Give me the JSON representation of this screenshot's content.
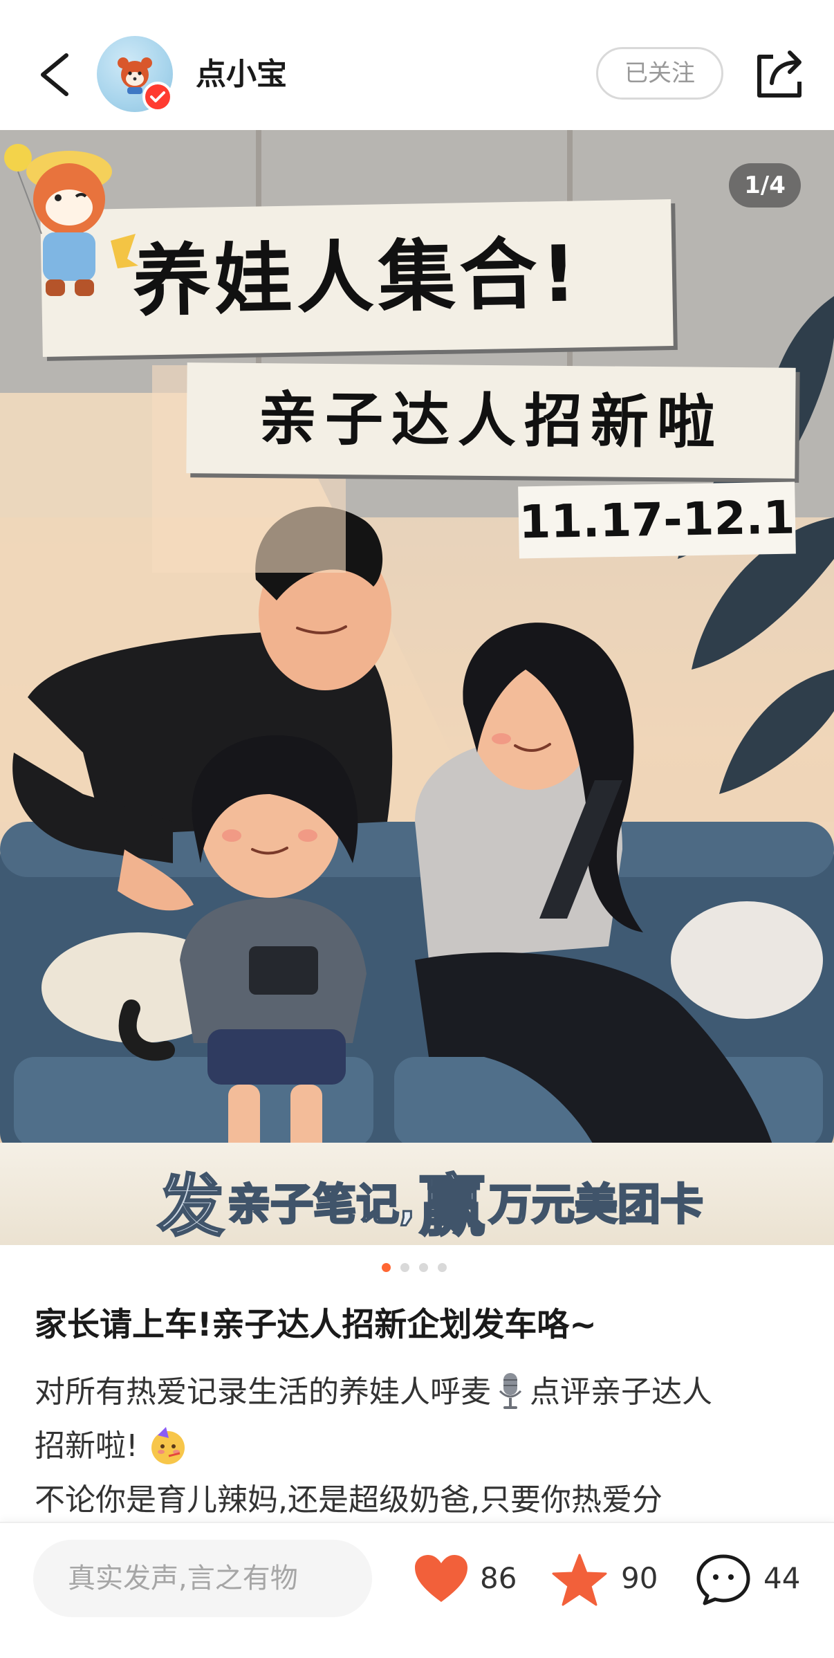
{
  "header": {
    "username": "点小宝",
    "follow_label": "已关注"
  },
  "hero": {
    "page_counter": "1/4",
    "headline": "养娃人集合!",
    "subheadline": "亲子达人招新啦",
    "date_range": "11.17-12.1",
    "promo": {
      "part1": "发",
      "part2": "亲子笔记,",
      "part3": "赢",
      "part4": "万元美团卡"
    },
    "total_pages": 4,
    "active_page": 1
  },
  "post": {
    "title": "家长请上车!亲子达人招新企划发车咯~",
    "body_line1_a": "对所有热爱记录生活的养娃人呼麦",
    "body_line1_b": "点评亲子达人",
    "body_line2": "招新啦!",
    "body_line3": "不论你是育儿辣妈,还是超级奶爸,只要你热爱分"
  },
  "bottom_bar": {
    "comment_placeholder": "真实发声,言之有物",
    "likes": "86",
    "favorites": "90",
    "comments": "44"
  },
  "colors": {
    "accent": "#ff6633",
    "heart": "#f2603a",
    "star": "#f2603a",
    "verified": "#ff3b30"
  },
  "icons": [
    "back-icon",
    "verified-icon",
    "share-icon",
    "heart-icon",
    "star-icon",
    "comment-icon",
    "microphone-emoji",
    "party-face-emoji"
  ]
}
